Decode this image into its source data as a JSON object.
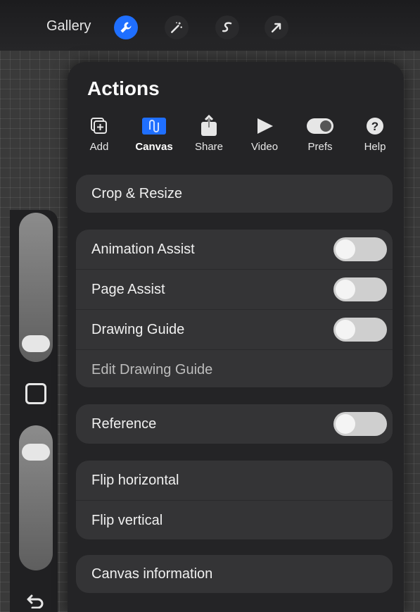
{
  "topbar": {
    "gallery_label": "Gallery",
    "tools": [
      "wrench-icon",
      "magic-wand-icon",
      "selection-icon",
      "transform-arrow-icon"
    ]
  },
  "accent": "#1f6fff",
  "actions": {
    "title": "Actions",
    "tabs": [
      {
        "label": "Add",
        "icon": "add-layer-icon"
      },
      {
        "label": "Canvas",
        "icon": "canvas-icon"
      },
      {
        "label": "Share",
        "icon": "share-icon"
      },
      {
        "label": "Video",
        "icon": "play-icon"
      },
      {
        "label": "Prefs",
        "icon": "toggle-icon"
      },
      {
        "label": "Help",
        "icon": "help-icon"
      }
    ],
    "active_tab": "Canvas",
    "crop_resize": "Crop & Resize",
    "assist_group": {
      "animation_assist": "Animation Assist",
      "page_assist": "Page Assist",
      "drawing_guide": "Drawing Guide",
      "edit_drawing_guide": "Edit Drawing Guide"
    },
    "reference": "Reference",
    "flip_group": {
      "flip_horizontal": "Flip horizontal",
      "flip_vertical": "Flip vertical"
    },
    "canvas_information": "Canvas information"
  },
  "sidebar": {
    "brush_size_level": 0.06,
    "opacity_level": 0.94
  }
}
